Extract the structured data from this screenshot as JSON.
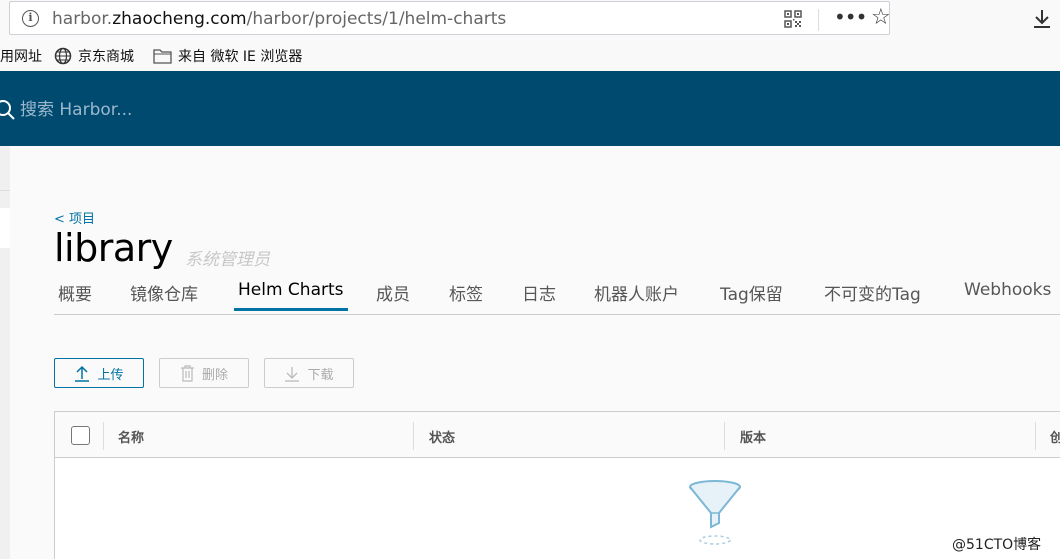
{
  "browser": {
    "url_prefix": "harbor.",
    "url_domain": "zhaocheng.com",
    "url_path": "/harbor/projects/1/helm-charts",
    "bookmarks": [
      {
        "label": "用网址",
        "icon": "none"
      },
      {
        "label": "京东商城",
        "icon": "globe-icon"
      },
      {
        "label": "来自 微软 IE 浏览器",
        "icon": "folder-icon"
      }
    ]
  },
  "header": {
    "search_placeholder": "搜索 Harbor..."
  },
  "project": {
    "breadcrumb": "< 项目",
    "title": "library",
    "role": "系统管理员"
  },
  "tabs": [
    {
      "label": "概要",
      "active": false
    },
    {
      "label": "镜像仓库",
      "active": false
    },
    {
      "label": "Helm Charts",
      "active": true
    },
    {
      "label": "成员",
      "active": false
    },
    {
      "label": "标签",
      "active": false
    },
    {
      "label": "日志",
      "active": false
    },
    {
      "label": "机器人账户",
      "active": false
    },
    {
      "label": "Tag保留",
      "active": false
    },
    {
      "label": "不可变的Tag",
      "active": false
    },
    {
      "label": "Webhooks",
      "active": false
    }
  ],
  "toolbar": {
    "upload_label": "上传",
    "delete_label": "删除",
    "download_label": "下载"
  },
  "table": {
    "columns": [
      "名称",
      "状态",
      "版本",
      "创"
    ]
  },
  "watermark": "@51CTO博客",
  "colors": {
    "header_bg": "#004a70",
    "accent": "#0072a3"
  }
}
